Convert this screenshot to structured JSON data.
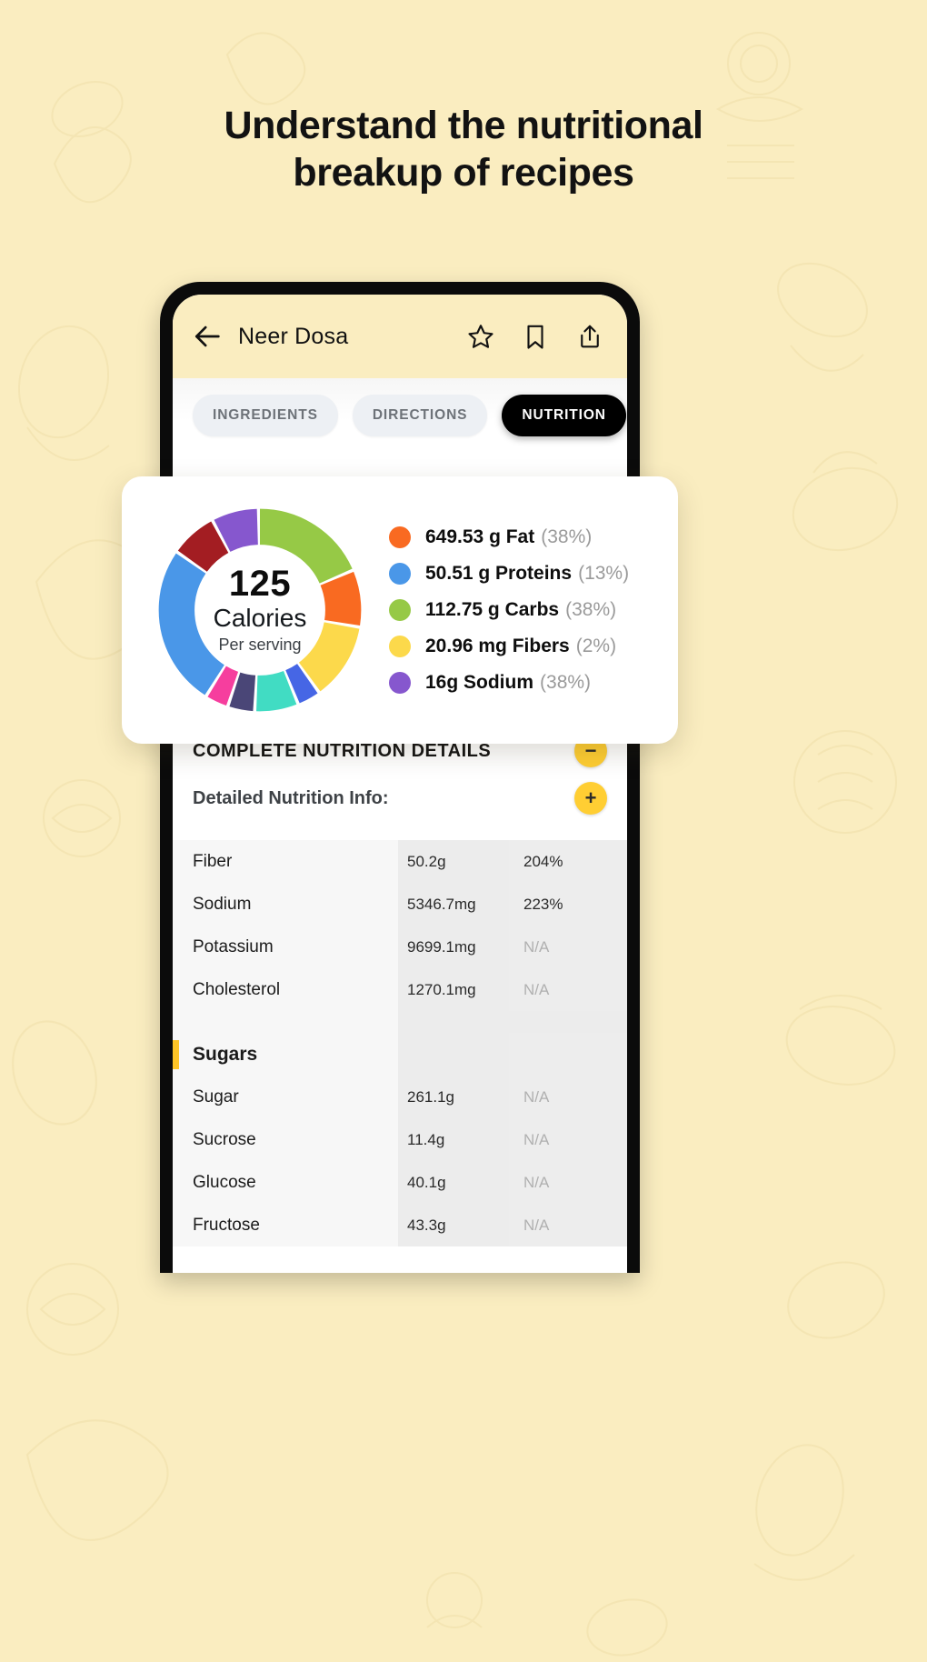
{
  "page": {
    "background_color": "#FAEDC0",
    "headline_line1": "Understand the nutritional",
    "headline_line2": "breakup of recipes"
  },
  "phone": {
    "appbar": {
      "back_icon": "arrow-left-icon",
      "title": "Neer Dosa",
      "actions": [
        {
          "name": "star-icon",
          "label": "Favorite"
        },
        {
          "name": "bookmark-icon",
          "label": "Bookmark"
        },
        {
          "name": "share-icon",
          "label": "Share"
        }
      ]
    },
    "tabs": [
      {
        "label": "INGREDIENTS",
        "active": false
      },
      {
        "label": "DIRECTIONS",
        "active": false
      },
      {
        "label": "NUTRITION",
        "active": true
      }
    ],
    "details": {
      "section_title": "COMPLETE NUTRITION DETAILS",
      "collapse_label": "−",
      "subsection_title": "Detailed Nutrition Info:",
      "expand_label": "+",
      "accent_color": "#FFCE33"
    },
    "table": {
      "rows": [
        {
          "name": "Fiber",
          "value": "50.2g",
          "percent": "204%",
          "na": false,
          "group": false
        },
        {
          "name": "Sodium",
          "value": "5346.7mg",
          "percent": "223%",
          "na": false,
          "group": false
        },
        {
          "name": "Potassium",
          "value": "9699.1mg",
          "percent": "N/A",
          "na": true,
          "group": false
        },
        {
          "name": "Cholesterol",
          "value": "1270.1mg",
          "percent": "N/A",
          "na": true,
          "group": false
        },
        {
          "name": "Sugars",
          "value": "",
          "percent": "",
          "na": false,
          "group": true
        },
        {
          "name": "Sugar",
          "value": "261.1g",
          "percent": "N/A",
          "na": true,
          "group": false
        },
        {
          "name": "Sucrose",
          "value": "11.4g",
          "percent": "N/A",
          "na": true,
          "group": false
        },
        {
          "name": "Glucose",
          "value": "40.1g",
          "percent": "N/A",
          "na": true,
          "group": false
        },
        {
          "name": "Fructose",
          "value": "43.3g",
          "percent": "N/A",
          "na": true,
          "group": false
        }
      ]
    }
  },
  "nutrition_card": {
    "calories_number": "125",
    "calories_label": "Calories",
    "calories_sub": "Per serving"
  },
  "chart_data": {
    "type": "pie",
    "title": "Calorie breakdown per serving",
    "center_value": 125,
    "center_label": "Calories",
    "center_sublabel": "Per serving",
    "legend_position": "right",
    "legend": [
      {
        "label": "649.53 g Fat",
        "percent": "38%",
        "value": 649.53,
        "unit": "g",
        "nutrient": "Fat",
        "color": "#F96A21"
      },
      {
        "label": "50.51 g  Proteins",
        "percent": "13%",
        "value": 50.51,
        "unit": "g",
        "nutrient": "Proteins",
        "color": "#4A97E8"
      },
      {
        "label": "112.75 g Carbs",
        "percent": "38%",
        "value": 112.75,
        "unit": "g",
        "nutrient": "Carbs",
        "color": "#96C946"
      },
      {
        "label": "20.96 mg Fibers",
        "percent": "2%",
        "value": 20.96,
        "unit": "mg",
        "nutrient": "Fibers",
        "color": "#FCD94B"
      },
      {
        "label": "16g Sodium",
        "percent": "38%",
        "value": 16,
        "unit": "g",
        "nutrient": "Sodium",
        "color": "#8657CE"
      }
    ],
    "segments": [
      {
        "name": "Carbs",
        "color": "#96C946",
        "share": 17.5
      },
      {
        "name": "Fat",
        "color": "#F96A21",
        "share": 8.5
      },
      {
        "name": "Fibers",
        "color": "#FCD94B",
        "share": 11.5
      },
      {
        "name": "Blue",
        "color": "#4666E5",
        "share": 3.5
      },
      {
        "name": "Teal",
        "color": "#41DCC3",
        "share": 6.5
      },
      {
        "name": "Navy",
        "color": "#4A4677",
        "share": 4.0
      },
      {
        "name": "Pink",
        "color": "#F63E9E",
        "share": 3.5
      },
      {
        "name": "Proteins",
        "color": "#4A97E8",
        "share": 24.0
      },
      {
        "name": "Maroon",
        "color": "#A31D22",
        "share": 7.0
      },
      {
        "name": "Sodium",
        "color": "#8657CE",
        "share": 7.0
      }
    ]
  }
}
